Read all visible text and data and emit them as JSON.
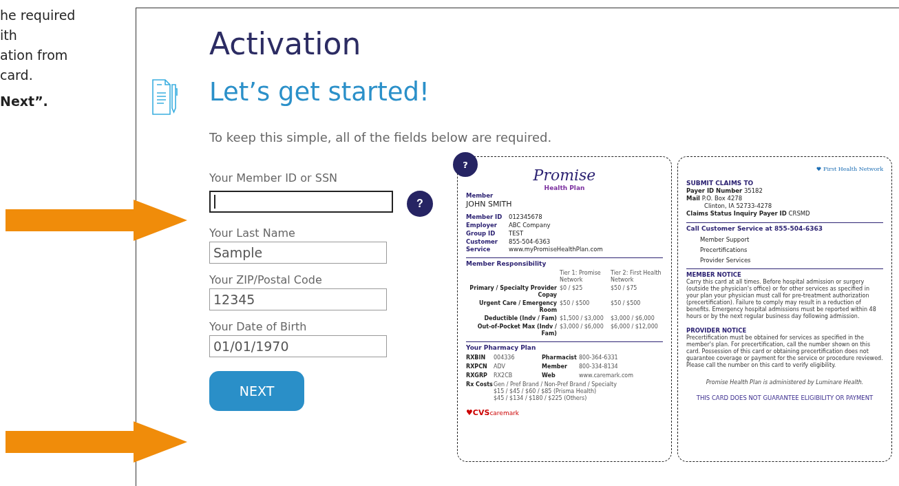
{
  "instructions": {
    "lines": [
      "he required",
      "ith",
      "ation from",
      "card."
    ],
    "last_line": "Next”."
  },
  "page": {
    "title": "Activation",
    "heading": "Let’s get started!",
    "subtitle": "To keep this simple, all of the fields below are required."
  },
  "fields": [
    {
      "label": "Your Member ID or SSN",
      "focused": true,
      "help": "?"
    },
    {
      "label": "Your Last Name",
      "focused": false,
      "value": "Sample"
    },
    {
      "label": "Your ZIP/Postal Code",
      "focused": false,
      "value": "12345"
    },
    {
      "label": "Your Date of Birth",
      "focused": false,
      "value": "01/01/1970"
    }
  ],
  "next_button": "NEXT",
  "card_help": "?",
  "card_front": {
    "logo": "Promise",
    "logo_sub": "Health Plan",
    "member_label": "Member",
    "member_name": "JOHN SMITH",
    "info": [
      {
        "label": "Member ID",
        "values": [
          "012345678"
        ]
      },
      {
        "label": "Employer",
        "values": [
          "ABC Company"
        ]
      },
      {
        "label": "Group ID",
        "values": [
          "TEST"
        ]
      },
      {
        "label": "Customer Service",
        "values": [
          "855-504-6363",
          "www.myPromiseHealthPlan.com"
        ]
      }
    ],
    "responsibility_title": "Member Responsibility",
    "tier_headers": [
      "Tier 1: Promise Network",
      "Tier 2: First Health Network"
    ],
    "responsibility_rows": [
      {
        "label": "Primary / Specialty Provider Copay",
        "tier1": "$0 / $25",
        "tier2": "$50 / $75"
      },
      {
        "label": "Urgent Care / Emergency Room",
        "tier1": "$50 / $500",
        "tier2": "$50 / $500"
      },
      {
        "label": "Deductible (Indv / Fam)",
        "tier1": "$1,500 / $3,000",
        "tier2": "$3,000 / $6,000"
      },
      {
        "label": "Out-of-Pocket Max (Indv / Fam)",
        "tier1": "$3,000 / $6,000",
        "tier2": "$6,000 / $12,000"
      }
    ],
    "pharmacy_title": "Your Pharmacy Plan",
    "pharmacy_rows": [
      {
        "label": "RXBIN",
        "value": "004336",
        "label2": "Pharmacist",
        "value2": "800-364-6331"
      },
      {
        "label": "RXPCN",
        "value": "ADV",
        "label2": "Member",
        "value2": "800-334-8134"
      },
      {
        "label": "RXGRP",
        "value": "RX2CB",
        "label2": "Web",
        "value2": "www.caremark.com"
      }
    ],
    "rx_costs_label": "Rx Costs",
    "rx_costs": [
      "Gen / Pref Brand / Non-Pref Brand / Specialty",
      "$15 / $45 / $60 / $85 (Prisma Health)",
      "$45 / $134 / $180 / $225 (Others)"
    ],
    "pharmacy_logo": "♥CVS",
    "pharmacy_logo_sub": "caremark"
  },
  "card_back": {
    "logo": "First Health Network",
    "claims_title": "SUBMIT CLAIMS TO",
    "claims_lines": [
      "**Payer ID Number** 35182",
      "**Mail** P.O. Box 4278",
      "Clinton, IA 52733-4278",
      "**Claims Status Inquiry Payer ID** CRSMD"
    ],
    "service_title": "Call Customer Service at 855-504-6363",
    "services": [
      "Member Support",
      "Precertifications",
      "Provider Services"
    ],
    "notices": [
      {
        "title": "MEMBER NOTICE",
        "text": "Carry this card at all times. Before hospital admission or surgery (outside the physician's office) or for other services as specified in your plan your physician must call for pre-treatment authorization (precertification). Failure to comply may result in a reduction of benefits. Emergency hospital admissions must be reported within 48 hours or by the next regular business day following admission."
      },
      {
        "title": "PROVIDER NOTICE",
        "text": "Precertification must be obtained for services as specified in the member's plan. For precertification, call the number shown on this card. Possession of this card or obtaining precertification does not guarantee coverage or payment for the service or procedure reviewed. Please call the number on this card to verify eligibility."
      }
    ],
    "administrator": "Promise Health Plan is administered by Luminare Health.",
    "disclaimer": "THIS CARD DOES NOT GUARANTEE ELIGIBILITY OR PAYMENT"
  }
}
